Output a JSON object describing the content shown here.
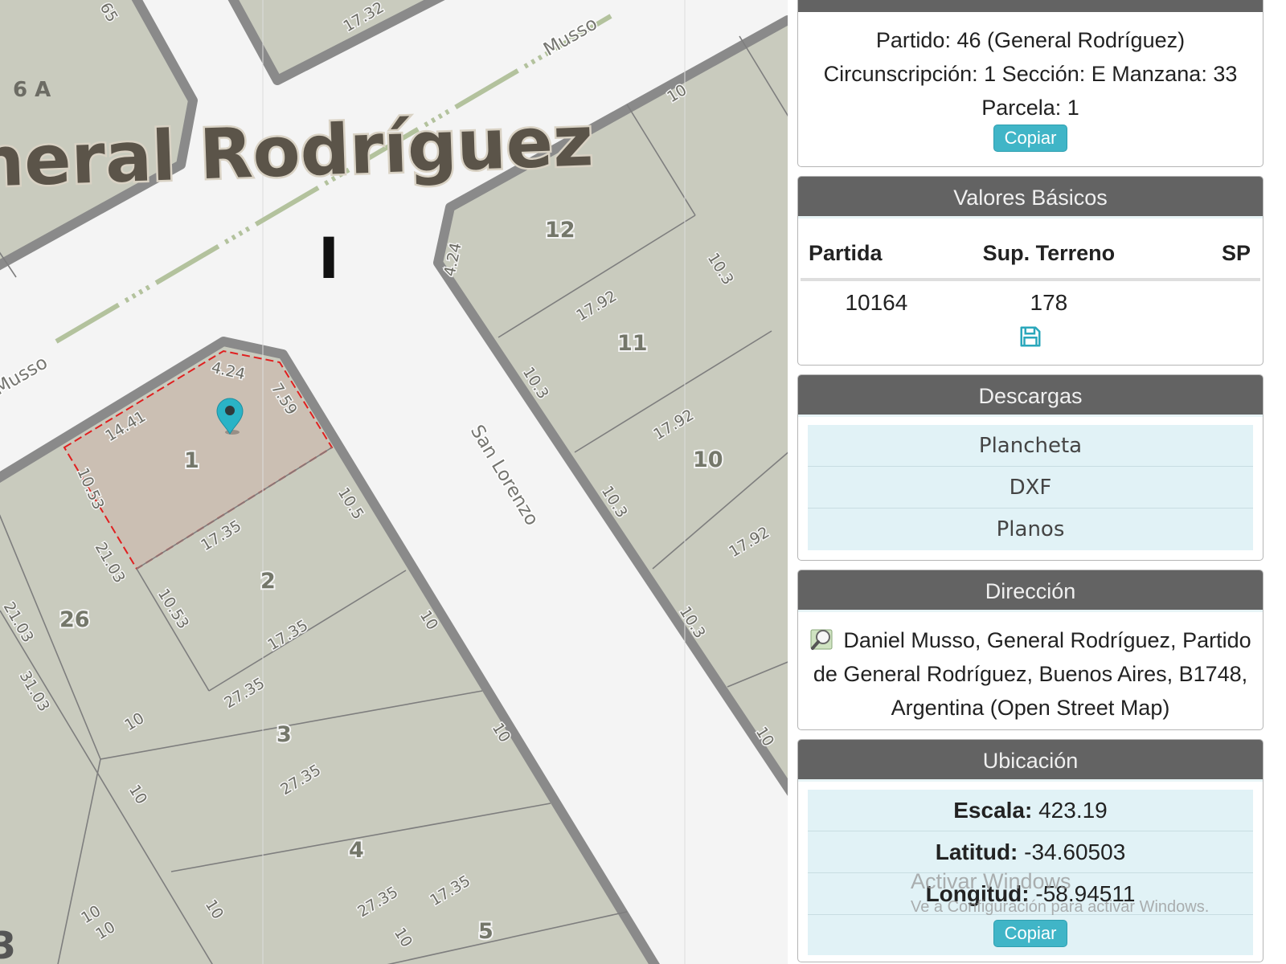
{
  "map": {
    "place_label": "neral Rodríguez",
    "locality_code": "6 A",
    "section_letter": "I",
    "corner_fragment": "3",
    "streets": {
      "musso": "Musso",
      "san_lorenzo": "San Lorenzo"
    },
    "parcel_numbers": {
      "p1": "1",
      "p2": "2",
      "p3": "3",
      "p4": "4",
      "p5": "5",
      "p10": "10",
      "p11": "11",
      "p12": "12",
      "p26": "26"
    },
    "dimensions": {
      "d1732": "17.32",
      "d65": "65",
      "d424a": "4.24",
      "d759": "7.59",
      "d1441": "14.41",
      "d1053a": "10.53",
      "d1735a": "17.35",
      "d2103a": "21.03",
      "d105": "10.5",
      "d1053b": "10.53",
      "d1735b": "17.35",
      "d2735a": "27.35",
      "d2103b": "21.03",
      "d3103": "31.03",
      "d10a": "10",
      "d10b": "10",
      "d10c": "10",
      "d10d": "10",
      "d10e": "10",
      "d10f": "10",
      "d10g": "10",
      "d10h": "10",
      "d2735b": "27.35",
      "d2735c": "27.35",
      "d1735c": "17.35",
      "d10i": "10",
      "d424b": "4.24",
      "d103a": "10.3",
      "d1792a": "17.92",
      "d103b": "10.3",
      "d1792b": "17.92",
      "d103c": "10.3",
      "d1792c": "17.92",
      "d103d": "10.3",
      "d10j": "10",
      "d10k": "10"
    },
    "marker_icon": "map-pin-icon"
  },
  "panel": {
    "info": {
      "partido": "Partido: 46 (General Rodríguez)",
      "nomenclatura": "Circunscripción: 1 Sección: E Manzana: 33",
      "parcela": "Parcela: 1",
      "copy_label": "Copiar"
    },
    "valores": {
      "title": "Valores Básicos",
      "headers": [
        "Partida",
        "Sup. Terreno",
        "SP"
      ],
      "row": {
        "partida": "10164",
        "sup_terreno": "178",
        "sp": ""
      },
      "save_icon": "save-icon"
    },
    "descargas": {
      "title": "Descargas",
      "items": [
        "Plancheta",
        "DXF",
        "Planos"
      ]
    },
    "direccion": {
      "title": "Dirección",
      "search_icon": "map-search-icon",
      "address": "Daniel Musso, General Rodríguez, Partido de General Rodríguez, Buenos Aires, B1748, Argentina (Open Street Map)"
    },
    "ubicacion": {
      "title": "Ubicación",
      "escala_label": "Escala:",
      "escala": "423.19",
      "latitud_label": "Latitud:",
      "latitud": "-34.60503",
      "longitud_label": "Longitud:",
      "longitud": "-58.94511",
      "copy_label": "Copiar"
    }
  },
  "watermark": {
    "line1": "Activar Windows",
    "line2": "Ve a Configuración para activar Windows."
  },
  "colors": {
    "block_fill": "#c9cbbe",
    "road": "#f4f4f4",
    "selected_parcel": "#cbbfb3",
    "selection_outline": "#e02020",
    "marker": "#2ab3c6",
    "panel_header": "#636363",
    "button": "#40b5c7"
  }
}
